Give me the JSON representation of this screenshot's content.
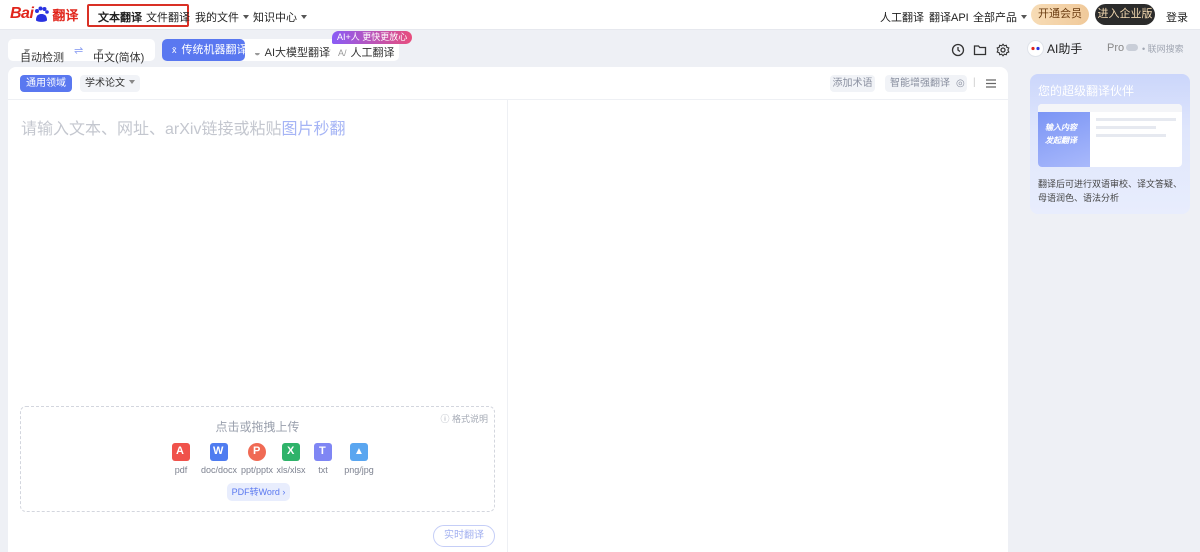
{
  "brand": {
    "logo_bai": "Bai",
    "logo_du": "du",
    "logo_fy": "翻译"
  },
  "nav": {
    "text_translate": "文本翻译",
    "file_translate": "文件翻译",
    "my_files": "我的文件",
    "knowledge": "知识中心",
    "human_translate": "人工翻译",
    "api": "翻译API",
    "all_products": "全部产品",
    "vip": "开通会员",
    "enterprise": "进入企业版",
    "login": "登录"
  },
  "lang": {
    "source": "自动检测",
    "swap_icon": "⇌",
    "target": "中文(简体)"
  },
  "modes": {
    "machine": "传统机器翻译",
    "llm": "AI大模型翻译",
    "human": "人工翻译",
    "badge": "AI+人 更快更放心"
  },
  "toolbar": {
    "history_icon": "clock-icon",
    "folder_icon": "folder-icon",
    "settings_icon": "gear-icon"
  },
  "panel": {
    "domain": "通用领域",
    "paper": "学术论文",
    "add_term": "添加术语",
    "smart_enhance": "智能增强翻译",
    "placeholder": "请输入文本、网址、arXiv链接或粘贴",
    "placeholder_link": "图片秒翻"
  },
  "upload": {
    "title": "点击或拖拽上传",
    "help": "格式说明",
    "types": [
      {
        "label": "pdf",
        "color": "#f0524b",
        "glyph": "A"
      },
      {
        "label": "doc/docx",
        "color": "#4f7cf0",
        "glyph": "W"
      },
      {
        "label": "ppt/pptx",
        "color": "#f06a54",
        "glyph": "P"
      },
      {
        "label": "xls/xlsx",
        "color": "#2fb36a",
        "glyph": "X"
      },
      {
        "label": "txt",
        "color": "#7f86f4",
        "glyph": "T"
      },
      {
        "label": "png/jpg",
        "color": "#5aa6f0",
        "glyph": "▲"
      }
    ],
    "pdf2word": "PDF转Word"
  },
  "translate_button": "实时翻译",
  "aside": {
    "title": "AI助手",
    "pro": "Pro",
    "net_search": "联网搜索",
    "card_title": "您的超级翻译伙伴",
    "card_banner_1": "输入内容",
    "card_banner_2": "发起翻译",
    "card_desc": "翻译后可进行双语审校、译文答疑、母语润色、语法分析"
  }
}
